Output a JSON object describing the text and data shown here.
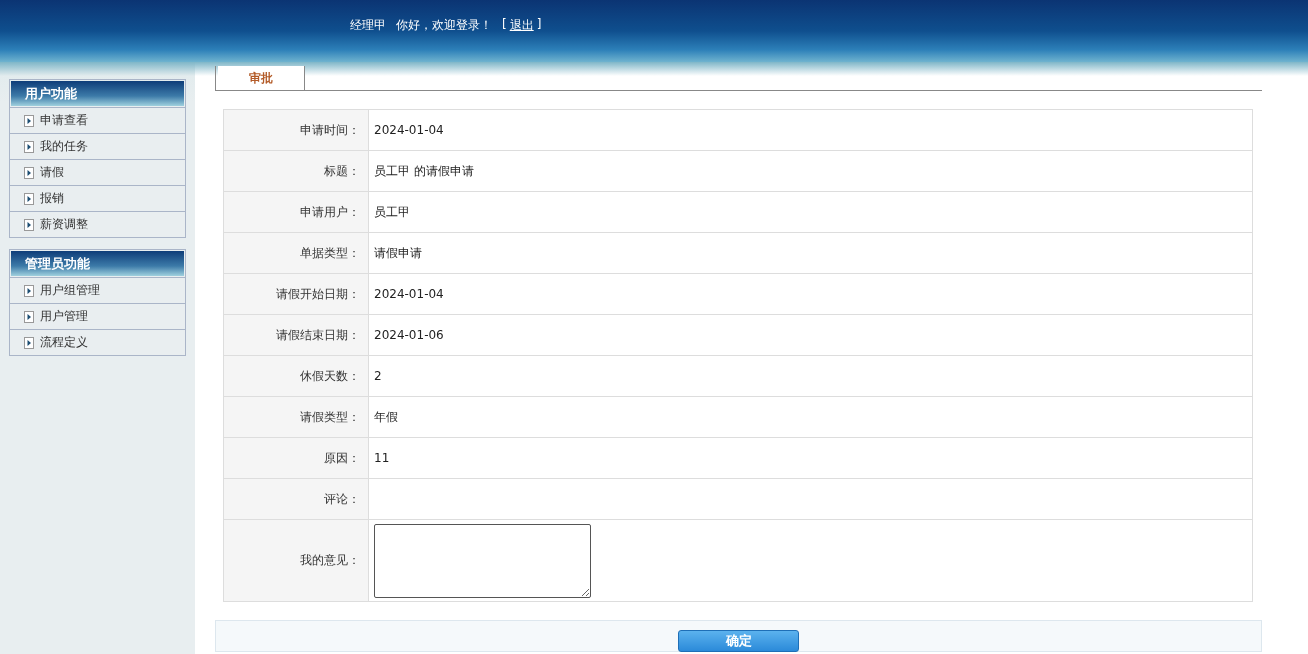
{
  "header": {
    "user": "经理甲",
    "greeting": "你好，欢迎登录！",
    "logout_open": "[",
    "logout": "退出",
    "logout_close": "]"
  },
  "sidebar": [
    {
      "title": "用户功能",
      "items": [
        "申请查看",
        "我的任务",
        "请假",
        "报销",
        "薪资调整"
      ]
    },
    {
      "title": "管理员功能",
      "items": [
        "用户组管理",
        "用户管理",
        "流程定义"
      ]
    }
  ],
  "tabs": [
    {
      "label": "审批",
      "selected": true
    }
  ],
  "form": [
    {
      "label": "申请时间：",
      "value": "2024-01-04"
    },
    {
      "label": "标题：",
      "value": "员工甲 的请假申请"
    },
    {
      "label": "申请用户：",
      "value": "员工甲"
    },
    {
      "label": "单据类型：",
      "value": "请假申请"
    },
    {
      "label": "请假开始日期：",
      "value": "2024-01-04"
    },
    {
      "label": "请假结束日期：",
      "value": "2024-01-06"
    },
    {
      "label": "休假天数：",
      "value": "2"
    },
    {
      "label": "请假类型：",
      "value": "年假"
    },
    {
      "label": "原因：",
      "value": "11"
    },
    {
      "label": "评论："
    },
    {
      "label": "我的意见：",
      "kind": "textarea"
    }
  ],
  "submit": "确定"
}
